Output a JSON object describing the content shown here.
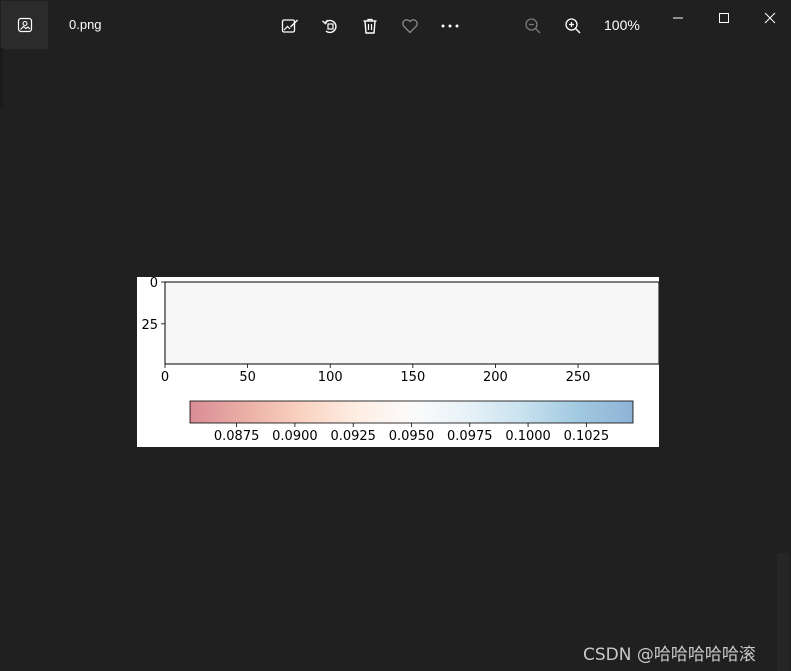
{
  "window": {
    "filename": "0.png",
    "zoom": "100%"
  },
  "toolbar": {
    "icons": [
      "edit-image-icon",
      "rotate-icon",
      "delete-icon",
      "favorite-icon",
      "more-icon"
    ],
    "zoom_out_icon": "zoom-out-icon",
    "zoom_in_icon": "zoom-in-icon"
  },
  "window_controls": {
    "minimize": "minimize-icon",
    "maximize": "maximize-icon",
    "close": "close-icon"
  },
  "chart_data": {
    "type": "heatmap",
    "title": "",
    "xlabel": "",
    "ylabel": "",
    "x_ticks": [
      "0",
      "50",
      "100",
      "150",
      "200",
      "250"
    ],
    "x_tick_values": [
      0,
      50,
      100,
      150,
      200,
      250
    ],
    "xlim": [
      0,
      299
    ],
    "y_ticks": [
      "0",
      "25"
    ],
    "y_tick_values": [
      0,
      25
    ],
    "ylim": [
      49,
      0
    ],
    "field_color": "#f7f7f7",
    "colorbar": {
      "orientation": "horizontal",
      "range": [
        0.0855,
        0.1045
      ],
      "ticks": [
        "0.0875",
        "0.0900",
        "0.0925",
        "0.0950",
        "0.0975",
        "0.1000",
        "0.1025"
      ],
      "tick_values": [
        0.0875,
        0.09,
        0.0925,
        0.095,
        0.0975,
        0.1,
        0.1025
      ],
      "colormap_stops": [
        "#b2182b",
        "#d6604d",
        "#f4a582",
        "#fddbc7",
        "#f7f7f7",
        "#d1e5f0",
        "#92c5de",
        "#4393c3",
        "#2166ac"
      ],
      "alpha": 0.5
    }
  },
  "watermark": "CSDN @哈哈哈哈哈滚"
}
